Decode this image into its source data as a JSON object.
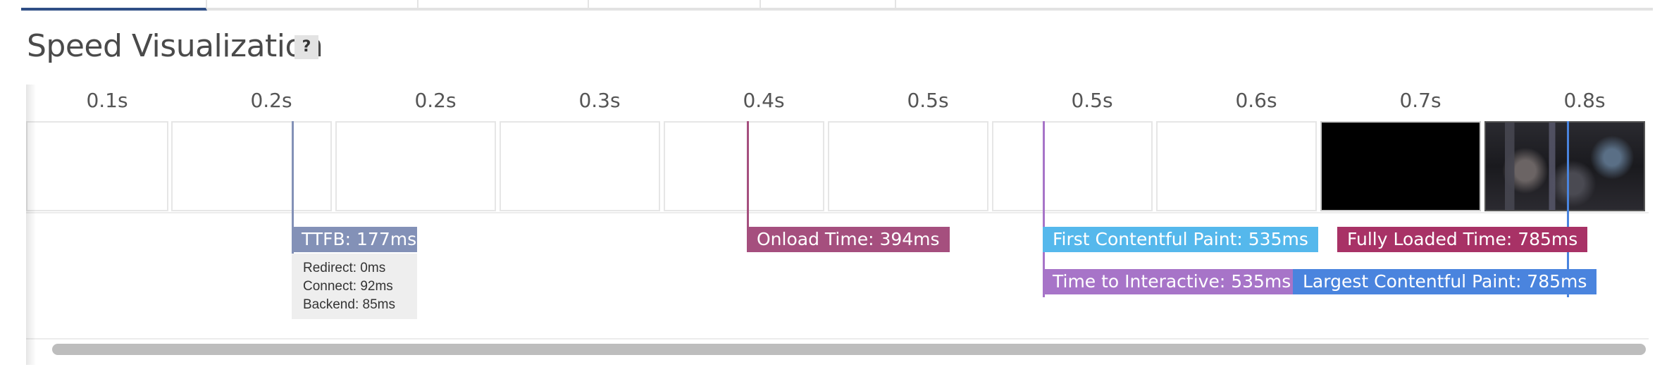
{
  "title": "Speed Visualization",
  "help_label": "?",
  "timeline": {
    "ticks": [
      "0.1s",
      "0.2s",
      "0.2s",
      "0.3s",
      "0.4s",
      "0.5s",
      "0.5s",
      "0.6s",
      "0.7s",
      "0.8s"
    ]
  },
  "markers": {
    "ttfb": {
      "label": "TTFB: 177ms",
      "color": "#8391b7"
    },
    "onload": {
      "label": "Onload Time: 394ms",
      "color": "#a54f7e"
    },
    "fcp": {
      "label": "First Contentful Paint: 535ms",
      "color": "#55b8ec"
    },
    "tti": {
      "label": "Time to Interactive: 535ms",
      "color": "#a774c8"
    },
    "fully_loaded": {
      "label": "Fully Loaded Time: 785ms",
      "color": "#a83266"
    },
    "lcp": {
      "label": "Largest Contentful Paint: 785ms",
      "color": "#4a84de"
    }
  },
  "ttfb_details": {
    "redirect": "Redirect: 0ms",
    "connect": "Connect: 92ms",
    "backend": "Backend: 85ms"
  }
}
